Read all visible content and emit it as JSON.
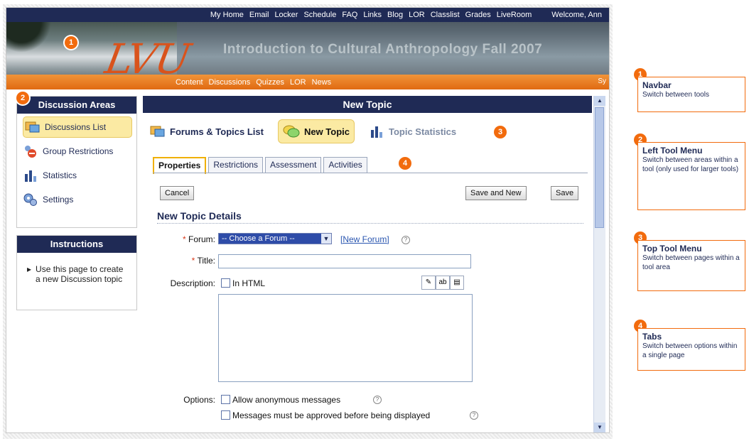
{
  "topnav": {
    "links": [
      "My Home",
      "Email",
      "Locker",
      "Schedule",
      "FAQ",
      "Links",
      "Blog",
      "LOR",
      "Classlist",
      "Grades",
      "LiveRoom"
    ],
    "welcome": "Welcome, Ann"
  },
  "header": {
    "logo": "LVU",
    "course_title": "Introduction to Cultural Anthropology Fall 2007"
  },
  "subnav": {
    "links": [
      "Content",
      "Discussions",
      "Quizzes",
      "LOR",
      "News"
    ],
    "more": "Sy"
  },
  "left_menu": {
    "title": "Discussion Areas",
    "items": [
      {
        "label": "Discussions List",
        "icon": "discussions-icon",
        "active": true
      },
      {
        "label": "Group Restrictions",
        "icon": "group-restrictions-icon",
        "active": false
      },
      {
        "label": "Statistics",
        "icon": "statistics-icon",
        "active": false
      },
      {
        "label": "Settings",
        "icon": "settings-icon",
        "active": false
      }
    ]
  },
  "instructions": {
    "title": "Instructions",
    "text": "Use this page to create a new Discussion topic"
  },
  "main": {
    "title": "New Topic",
    "tool_menu": [
      {
        "label": "Forums & Topics List"
      },
      {
        "label": "New Topic"
      },
      {
        "label": "Topic Statistics"
      }
    ],
    "tabs": [
      "Properties",
      "Restrictions",
      "Assessment",
      "Activities"
    ],
    "buttons": {
      "cancel": "Cancel",
      "save_new": "Save and New",
      "save": "Save"
    },
    "section_title": "New Topic Details",
    "form": {
      "forum_label": "Forum:",
      "forum_value": "-- Choose a Forum --",
      "new_forum_link": "[New Forum]",
      "title_label": "Title:",
      "title_value": "",
      "description_label": "Description:",
      "in_html_label": "In HTML",
      "options_label": "Options:",
      "option_anonymous": "Allow anonymous messages",
      "option_approved": "Messages must be approved before being displayed"
    }
  },
  "callouts": [
    {
      "num": "1",
      "title": "Navbar",
      "desc": "Switch between tools"
    },
    {
      "num": "2",
      "title": "Left Tool Menu",
      "desc": "Switch between areas within a tool (only used for larger tools)"
    },
    {
      "num": "3",
      "title": "Top Tool Menu",
      "desc": "Switch between pages within a tool area"
    },
    {
      "num": "4",
      "title": "Tabs",
      "desc": "Switch between options within a single page"
    }
  ],
  "colors": {
    "navy": "#1f2a55",
    "orange": "#f26b0d",
    "highlight": "#fbeaa3"
  }
}
